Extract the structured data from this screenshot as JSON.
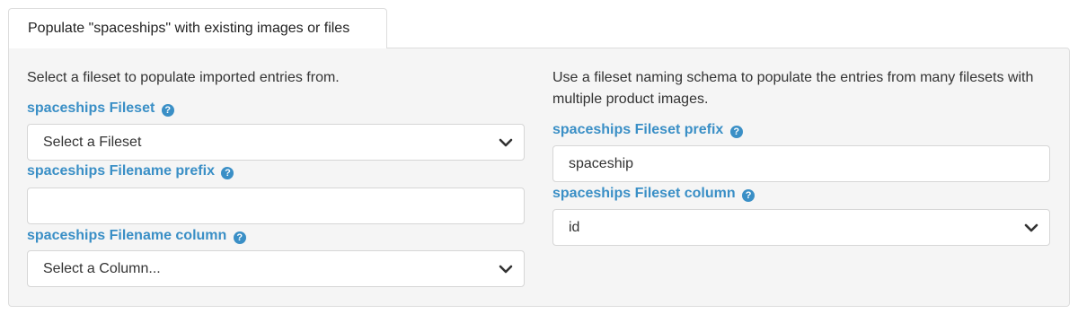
{
  "tab": {
    "label": "Populate \"spaceships\" with existing images or files"
  },
  "left": {
    "description": "Select a fileset to populate imported entries from.",
    "fileset": {
      "label": "spaceships Fileset",
      "value": "Select a Fileset"
    },
    "filename_prefix": {
      "label": "spaceships Filename prefix",
      "value": ""
    },
    "filename_column": {
      "label": "spaceships Filename column",
      "value": "Select a Column..."
    }
  },
  "right": {
    "description": "Use a fileset naming schema to populate the entries from many filesets with multiple product images.",
    "fileset_prefix": {
      "label": "spaceships Fileset prefix",
      "value": "spaceship"
    },
    "fileset_column": {
      "label": "spaceships Fileset column",
      "value": "id"
    }
  },
  "icons": {
    "help": "question-circle-icon",
    "dropdown": "chevron-down-icon"
  },
  "colors": {
    "label": "#3a8fc6",
    "panel_bg": "#f5f5f5",
    "border": "#dddddd"
  }
}
